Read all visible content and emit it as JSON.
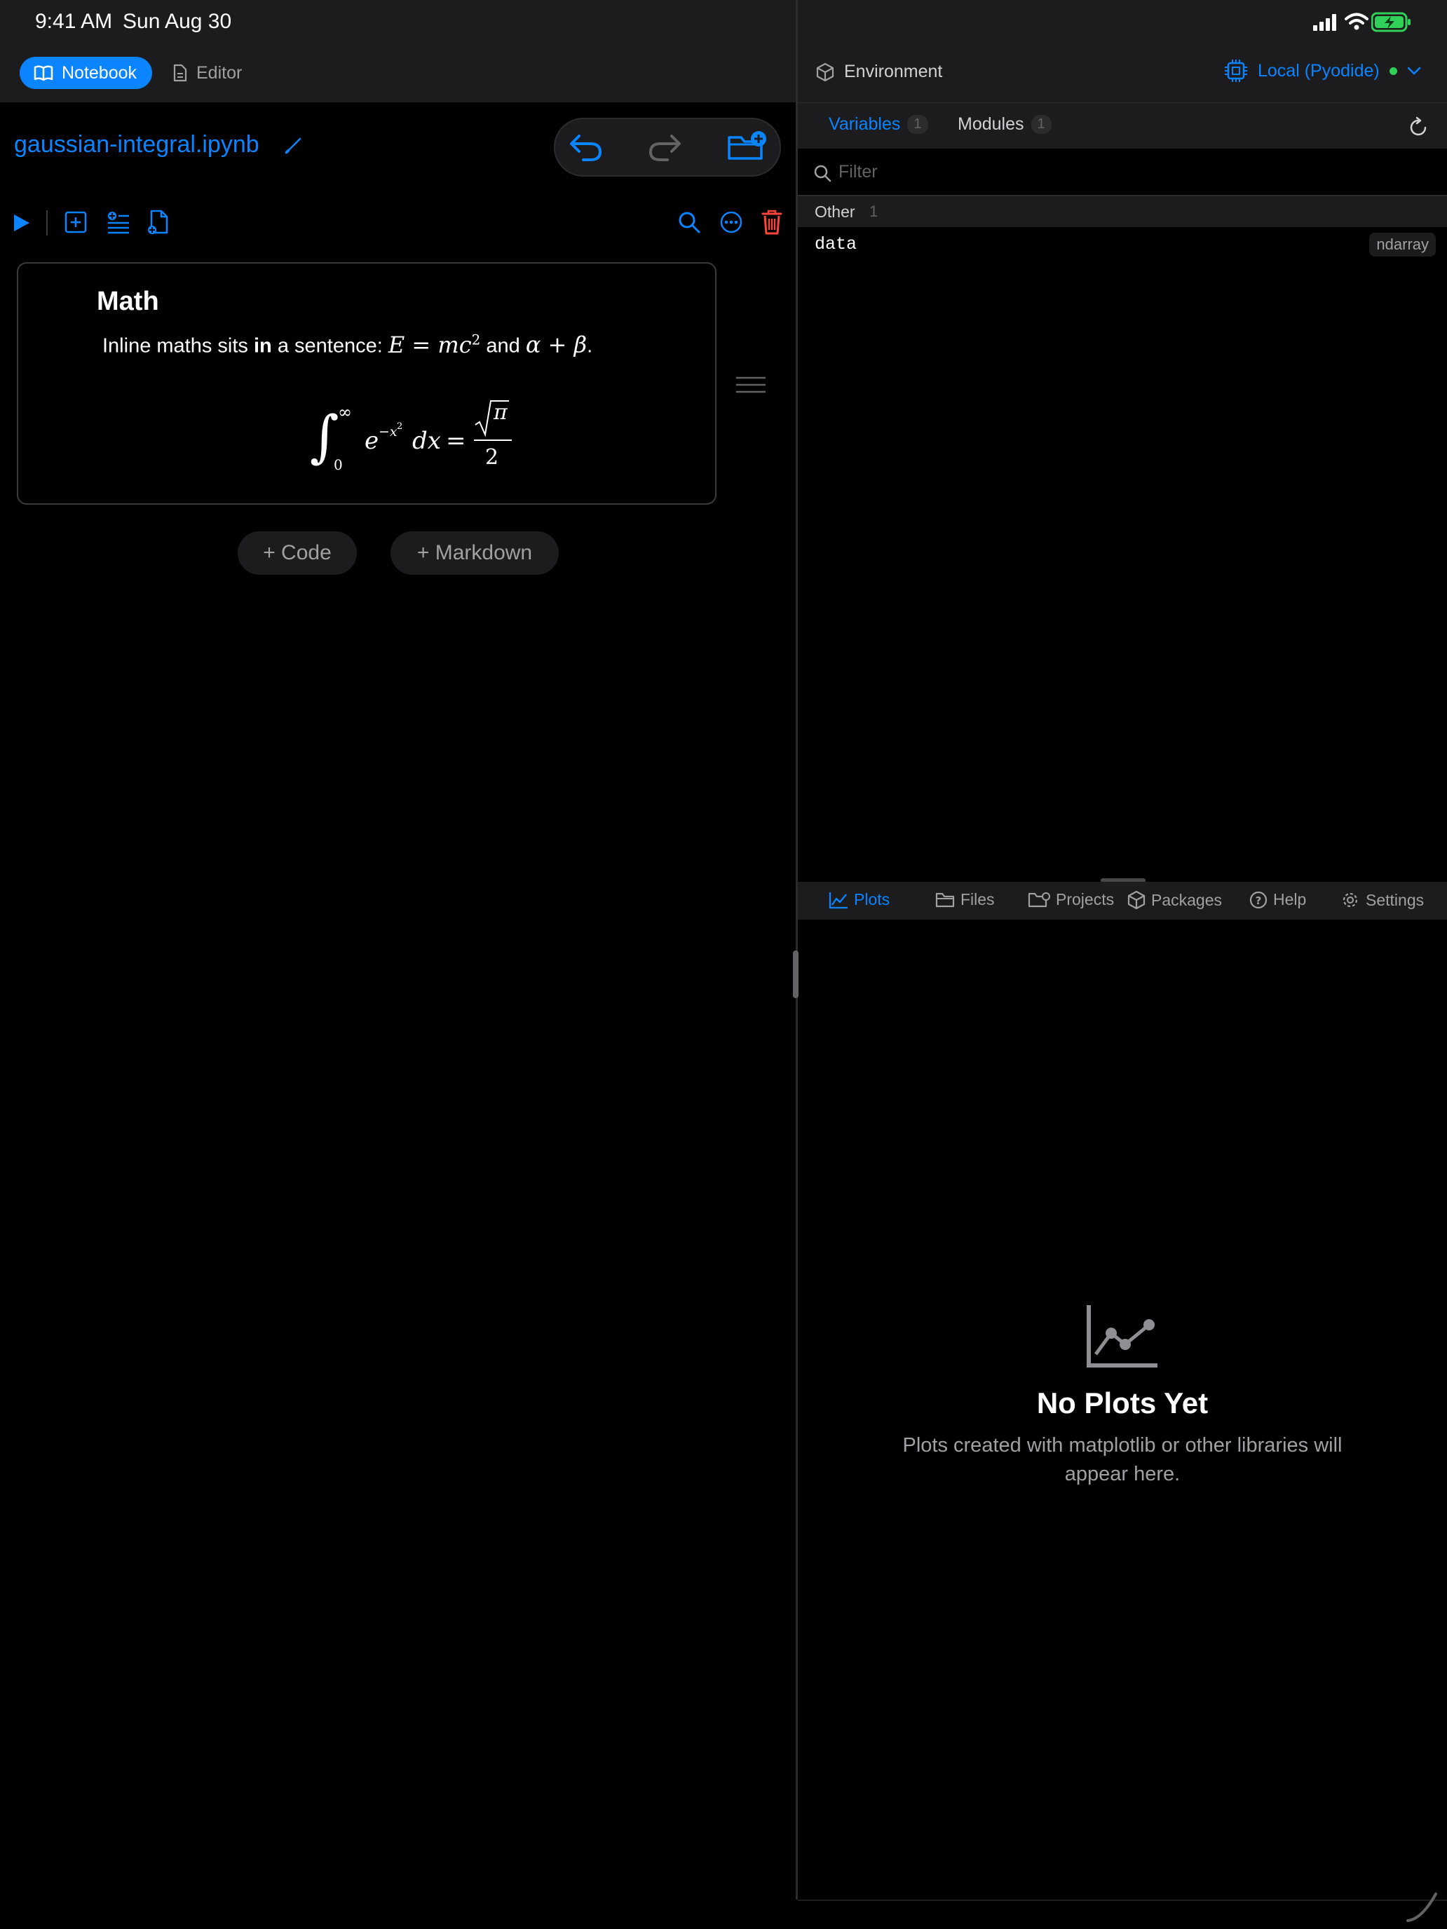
{
  "status_bar": {
    "time": "9:41 AM",
    "date": "Sun Aug 30"
  },
  "left_header": {
    "notebook_label": "Notebook",
    "editor_label": "Editor"
  },
  "notebook": {
    "filename": "gaussian-integral.ipynb"
  },
  "cell": {
    "heading": "Math",
    "sentence_pre": "Inline maths sits ",
    "sentence_bold": "in",
    "sentence_mid": " a sentence: ",
    "sentence_and": " and ",
    "sentence_end": "."
  },
  "add_buttons": {
    "code": "+ Code",
    "markdown": "+ Markdown"
  },
  "environment": {
    "label": "Environment",
    "kernel": "Local (Pyodide)",
    "kernel_status_color": "#30D158"
  },
  "var_tabs": [
    {
      "label": "Variables",
      "count": "1"
    },
    {
      "label": "Modules",
      "count": "1"
    }
  ],
  "filter": {
    "placeholder": "Filter"
  },
  "var_group": {
    "label": "Other",
    "count": "1"
  },
  "variables": [
    {
      "name": "data",
      "type": "ndarray"
    }
  ],
  "bottom_tabs": [
    "Plots",
    "Files",
    "Projects",
    "Packages",
    "Help",
    "Settings"
  ],
  "plots_empty": {
    "title": "No Plots Yet",
    "description": "Plots created with matplotlib or other libraries will appear here."
  },
  "colors": {
    "accent": "#0A84FF",
    "danger": "#FF453A",
    "background": "#000000",
    "panel": "#1C1C1E"
  }
}
